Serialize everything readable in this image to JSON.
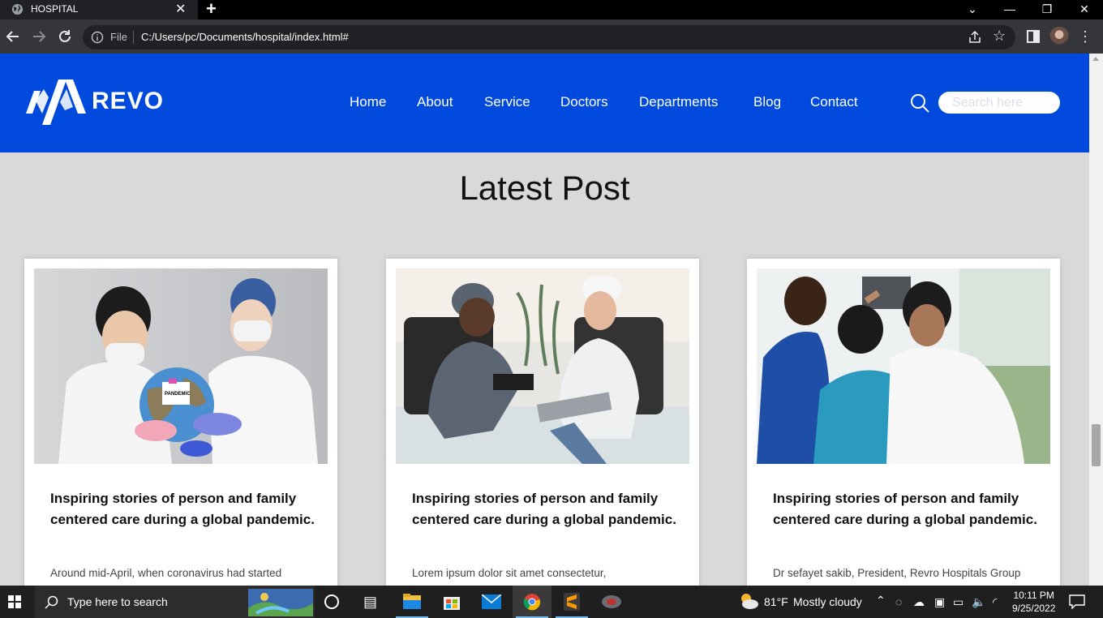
{
  "browser": {
    "tab_title": "HOSPITAL",
    "tab_close": "✕",
    "new_tab": "+",
    "file_label": "File",
    "url": "C:/Users/pc/Documents/hospital/index.html#",
    "window_controls": {
      "minimize": "—",
      "restore": "❐",
      "close": "✕"
    },
    "chevron": "⌄"
  },
  "site": {
    "brand": "REVO",
    "nav": [
      "Home",
      "About",
      "Service",
      "Doctors",
      "Departments",
      "Blog",
      "Contact"
    ],
    "search_placeholder": "Search here",
    "accent": "#0049dd"
  },
  "section": {
    "title": "Latest Post"
  },
  "posts": [
    {
      "title": "Inspiring stories of person and family centered care during a global pandemic.",
      "excerpt": "Around mid-April, when coronavirus had started",
      "badge": "PANDEMIC"
    },
    {
      "title": "Inspiring stories of person and family centered care during a global pandemic.",
      "excerpt": "Lorem ipsum dolor sit amet consectetur,"
    },
    {
      "title": "Inspiring stories of person and family centered care during a global pandemic.",
      "excerpt": "Dr sefayet sakib, President, Revro Hospitals Group"
    }
  ],
  "taskbar": {
    "search_text": "Type here to search",
    "weather_temp": "81°F",
    "weather_text": "Mostly cloudy",
    "time": "10:11 PM",
    "date": "9/25/2022"
  }
}
